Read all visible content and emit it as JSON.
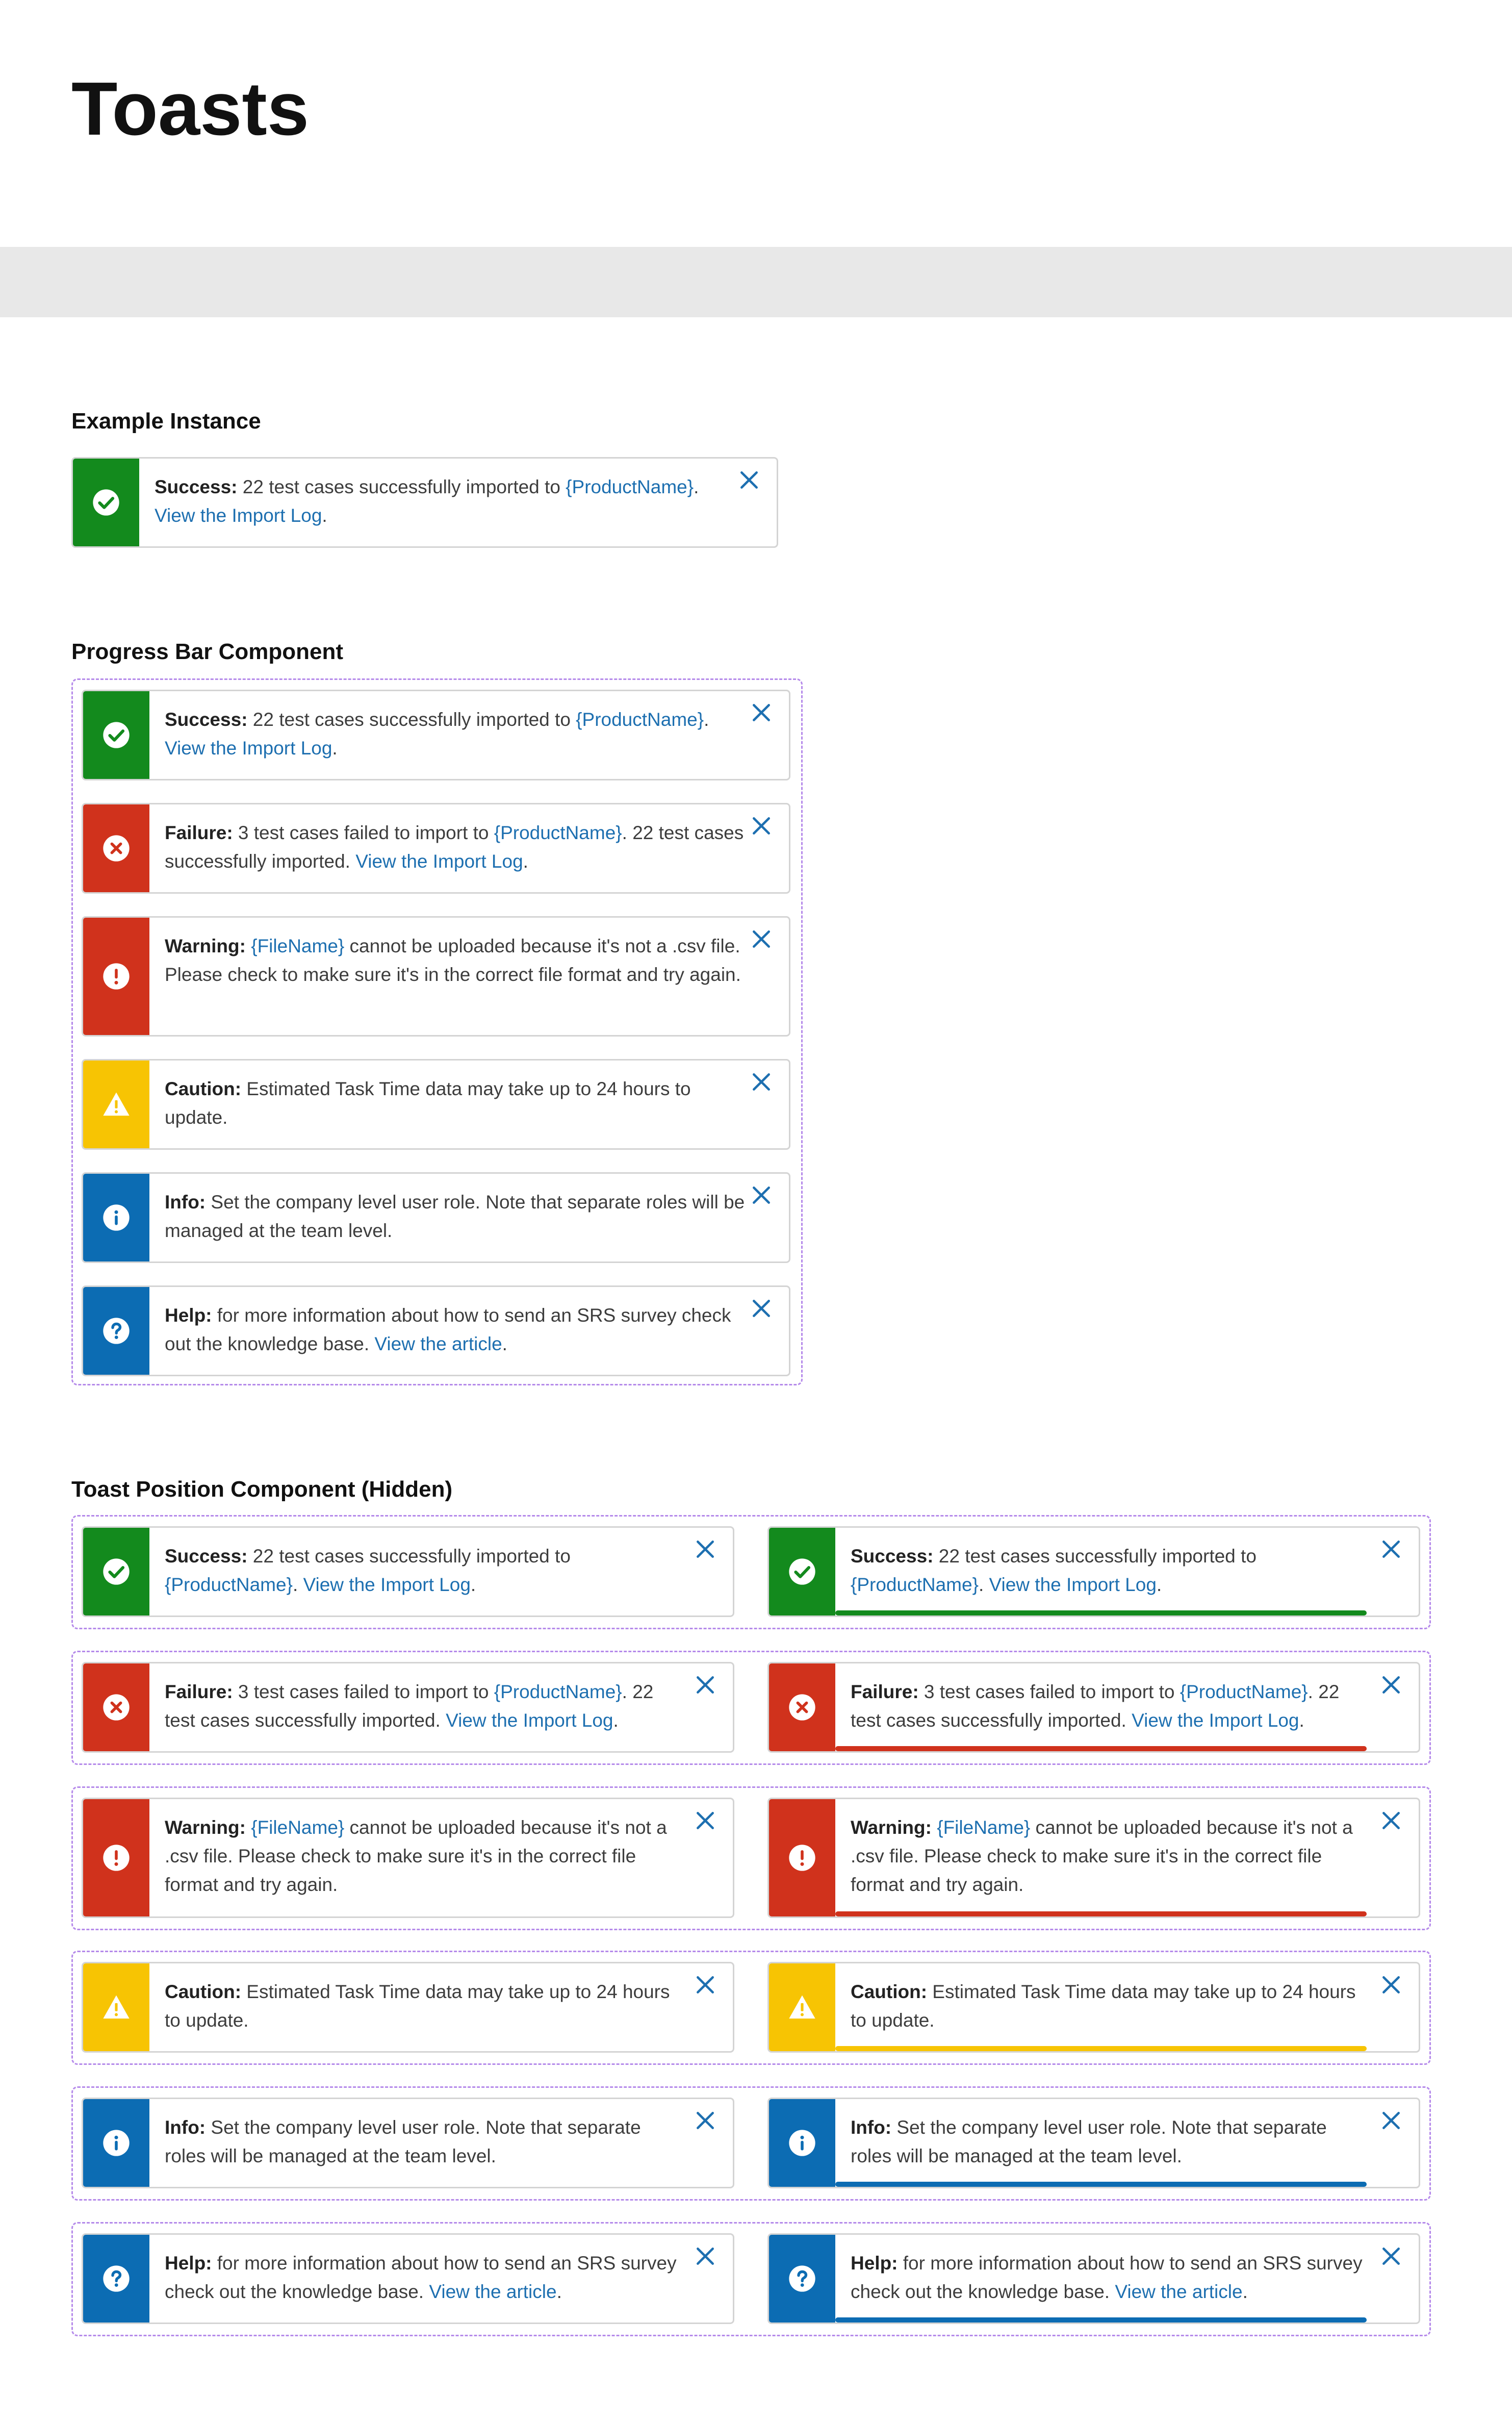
{
  "page_title": "Toasts",
  "sections": {
    "example": "Example Instance",
    "progress": "Progress Bar Component",
    "position": "Toast Position Component (Hidden)"
  },
  "colors": {
    "success": "#138a1d",
    "failure": "#d0321c",
    "warning": "#d0321c",
    "caution": "#f7c403",
    "info": "#0c6cb3",
    "help": "#0c6cb3",
    "link": "#1d6fb0",
    "close": "#1d6fb0",
    "dashed_border": "#b58aea"
  },
  "toasts": {
    "success": {
      "type": "success",
      "icon": "check-circle-icon",
      "label": "Success:",
      "segments": [
        {
          "t": " 22 test cases successfully imported to ",
          "l": false
        },
        {
          "t": "{ProductName}",
          "l": true
        },
        {
          "t": ". ",
          "l": false
        },
        {
          "t": "View the Import Log",
          "l": true
        },
        {
          "t": ".",
          "l": false
        }
      ]
    },
    "failure": {
      "type": "failure",
      "icon": "x-circle-icon",
      "label": "Failure:",
      "segments": [
        {
          "t": " 3 test cases failed to import to ",
          "l": false
        },
        {
          "t": "{ProductName}",
          "l": true
        },
        {
          "t": ". 22 test cases successfully imported. ",
          "l": false
        },
        {
          "t": "View the Import Log",
          "l": true
        },
        {
          "t": ".",
          "l": false
        }
      ]
    },
    "warning": {
      "type": "warning",
      "icon": "exclamation-circle-icon",
      "label": "Warning:",
      "segments": [
        {
          "t": " ",
          "l": false
        },
        {
          "t": "{FileName}",
          "l": true
        },
        {
          "t": " cannot be uploaded because it's not a .csv file. Please check to make sure it's in the correct file format and try again.",
          "l": false
        }
      ]
    },
    "caution": {
      "type": "caution",
      "icon": "warning-triangle-icon",
      "label": "Caution:",
      "segments": [
        {
          "t": " Estimated Task Time data may take up to 24 hours to update.",
          "l": false
        }
      ]
    },
    "info": {
      "type": "info",
      "icon": "info-circle-icon",
      "label": "Info:",
      "segments": [
        {
          "t": " Set the company level user role. Note that separate roles will be managed at the team level.",
          "l": false
        }
      ]
    },
    "help": {
      "type": "help",
      "icon": "question-circle-icon",
      "label": "Help:",
      "segments": [
        {
          "t": " for more information about how to send an SRS survey check out the knowledge base. ",
          "l": false
        },
        {
          "t": "View the article",
          "l": true
        },
        {
          "t": ".",
          "l": false
        }
      ]
    }
  },
  "example_instance": [
    "success"
  ],
  "progress_stack": [
    "success",
    "failure",
    "warning",
    "caution",
    "info",
    "help"
  ],
  "position_rows": [
    {
      "toast": "success",
      "progress": 1.0
    },
    {
      "toast": "failure",
      "progress": 1.0
    },
    {
      "toast": "warning",
      "progress": 1.0
    },
    {
      "toast": "caution",
      "progress": 1.0
    },
    {
      "toast": "info",
      "progress": 1.0
    },
    {
      "toast": "help",
      "progress": 1.0
    }
  ]
}
